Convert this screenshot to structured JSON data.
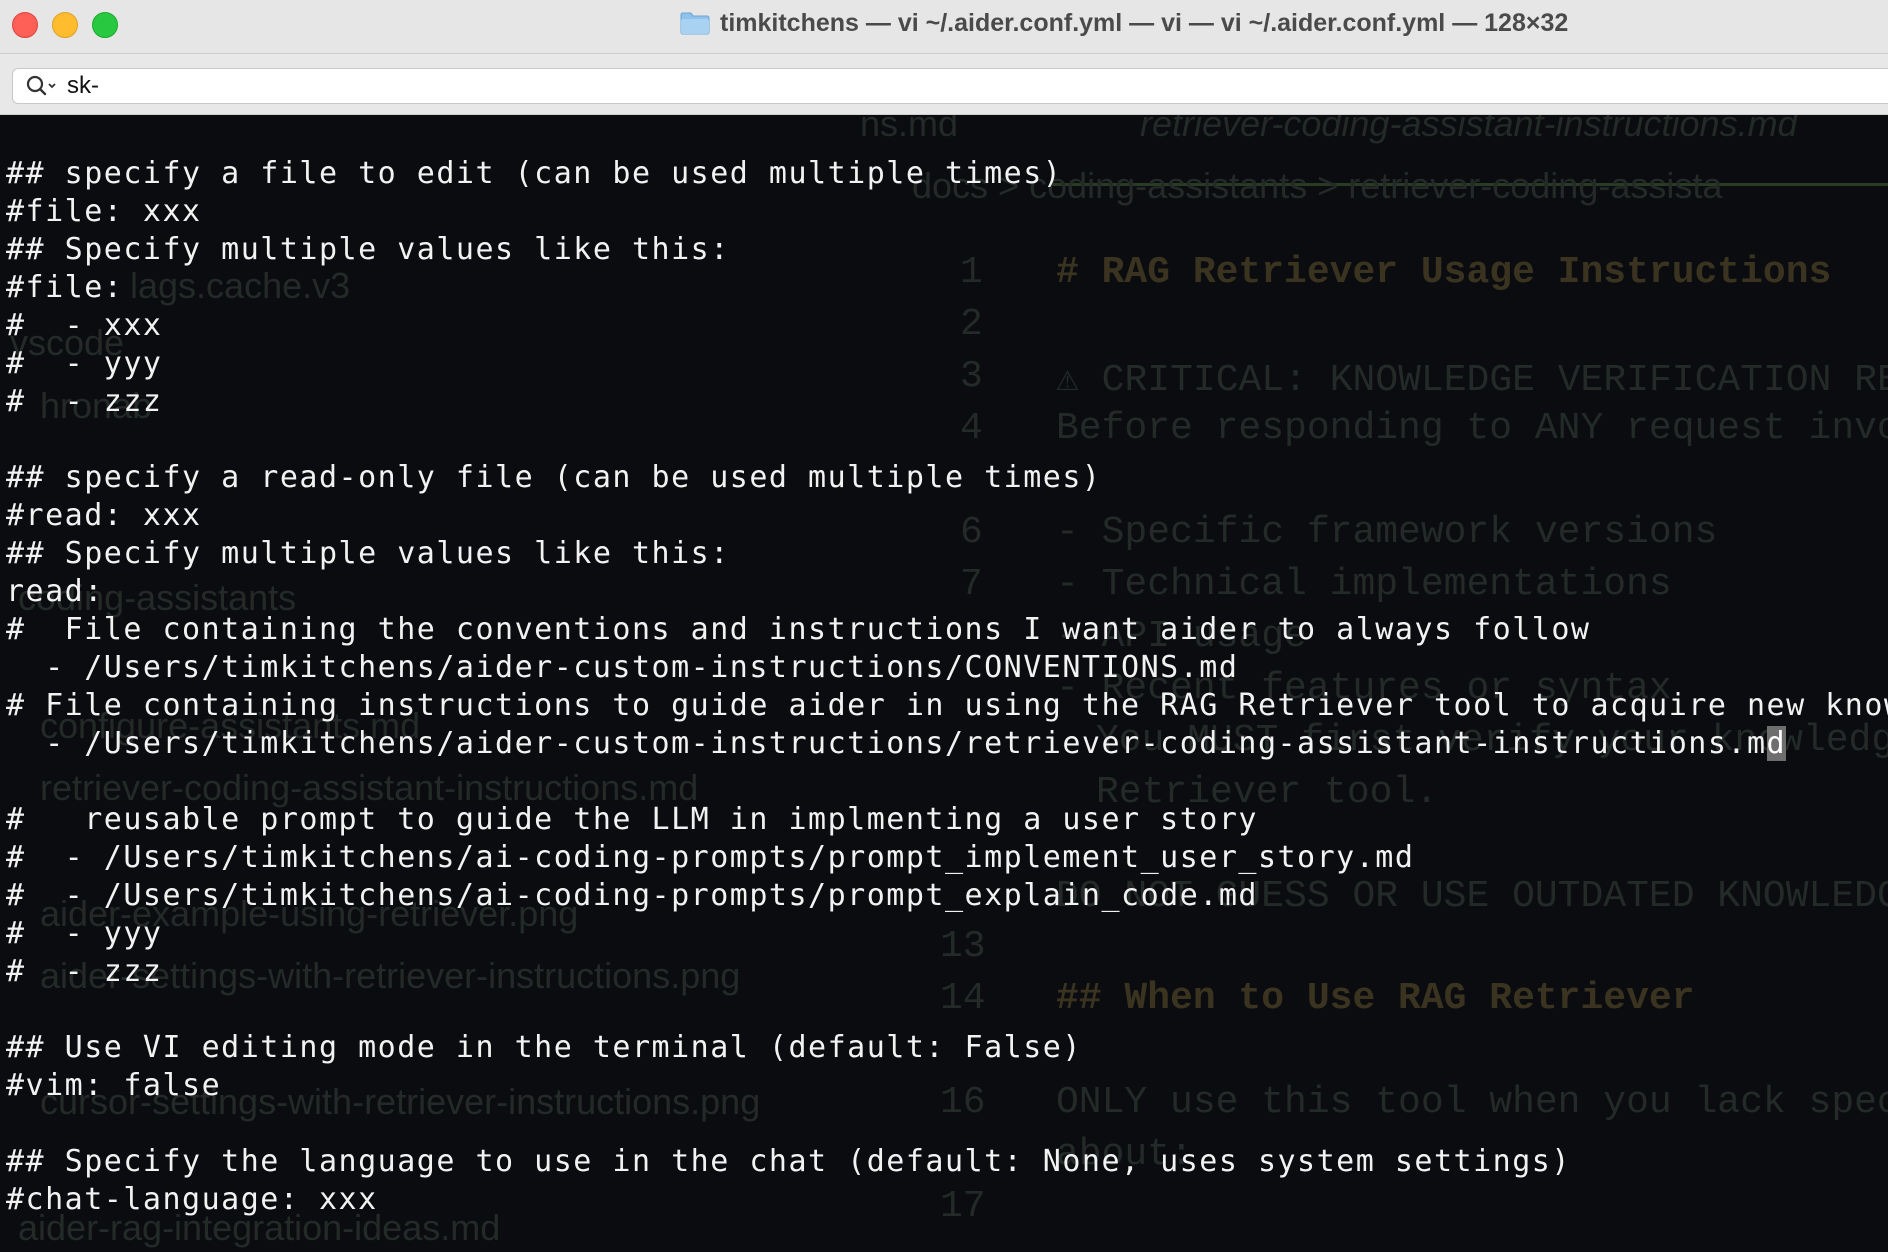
{
  "window": {
    "title": "timkitchens — vi ~/.aider.conf.yml — vi — vi ~/.aider.conf.yml — 128×32"
  },
  "search": {
    "value": "sk-"
  },
  "terminal": {
    "lines": [
      "## specify a file to edit (can be used multiple times)",
      "#file: xxx",
      "## Specify multiple values like this:",
      "#file:",
      "#  - xxx",
      "#  - yyy",
      "#  - zzz",
      "",
      "## specify a read-only file (can be used multiple times)",
      "#read: xxx",
      "## Specify multiple values like this:",
      "read:",
      "#  File containing the conventions and instructions I want aider to always follow",
      "  - /Users/timkitchens/aider-custom-instructions/CONVENTIONS.md",
      "# File containing instructions to guide aider in using the RAG Retriever tool to acquire new knowledge",
      "  - /Users/timkitchens/aider-custom-instructions/retriever-coding-assistant-instructions.m",
      "",
      "#   reusable prompt to guide the LLM in implmenting a user story",
      "#  - /Users/timkitchens/ai-coding-prompts/prompt_implement_user_story.md",
      "#  - /Users/timkitchens/ai-coding-prompts/prompt_explain_code.md",
      "#  - yyy",
      "#  - zzz",
      "",
      "## Use VI editing mode in the terminal (default: False)",
      "#vim: false",
      "",
      "## Specify the language to use in the chat (default: None, uses system settings)",
      "#chat-language: xxx"
    ],
    "cursor_char": "d"
  },
  "background_editor": {
    "tab_title": "retriever-coding-assistant-instructions.md",
    "partial_tab": "ns.md",
    "breadcrumb": "docs  >  coding-assistants  >  retriever-coding-assista",
    "sidebar_items": [
      "lags.cache.v3",
      "vscode",
      "hronab",
      "coding-assistants",
      "configure-assistants.md",
      "retriever-coding-assistant-instructions.md",
      "aider-example-using-retriever.png",
      "aider-settings-with-retriever-instructions.png",
      "cursor-settings-with-retriever-instructions.png",
      "aider-rag-integration-ideas.md"
    ],
    "line_numbers": [
      "1",
      "2",
      "3",
      "4",
      "6",
      "7",
      "13",
      "14",
      "16",
      "17"
    ],
    "code_lines": [
      "# RAG Retriever Usage Instructions",
      "⚠ CRITICAL: KNOWLEDGE VERIFICATION REQUI",
      "Before responding to ANY request involvi",
      "- Specific framework versions",
      "- Technical implementations",
      "- API usage",
      "- Recent features or syntax",
      "You MUST first verify your knowledge u",
      "Retriever tool.",
      "DO NOT GUESS OR USE OUTDATED KNOWLEDGE!",
      "## When to Use RAG Retriever",
      "ONLY use this tool when you lack specifi",
      "about:"
    ]
  },
  "colors": {
    "terminal_bg": "#0b0c0f",
    "terminal_fg": "#f2f2f2",
    "close": "#fe5f57",
    "minimize": "#febc2e",
    "maximize": "#28c840"
  }
}
